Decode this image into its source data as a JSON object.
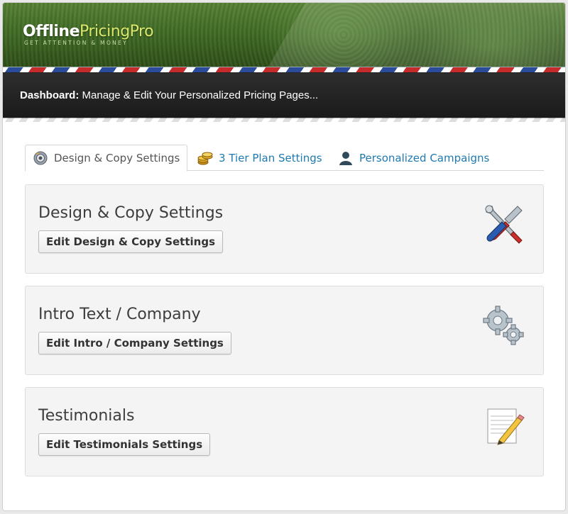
{
  "header": {
    "logo_part1": "Offline",
    "logo_part2": "PricingPro",
    "logo_tagline": "GET ATTENTION & MONEY",
    "dashboard_label": "Dashboard:",
    "dashboard_text": " Manage & Edit Your Personalized Pricing Pages..."
  },
  "tabs": [
    {
      "label": "Design & Copy Settings",
      "icon": "palette-gear-icon",
      "active": true
    },
    {
      "label": "3 Tier Plan Settings",
      "icon": "coins-icon",
      "active": false
    },
    {
      "label": "Personalized Campaigns",
      "icon": "user-icon",
      "active": false
    }
  ],
  "panels": [
    {
      "title": "Design & Copy Settings",
      "button": "Edit Design & Copy Settings",
      "icon": "tools-icon"
    },
    {
      "title": "Intro Text / Company",
      "button": "Edit Intro / Company Settings",
      "icon": "gears-icon"
    },
    {
      "title": "Testimonials",
      "button": "Edit Testimonials Settings",
      "icon": "document-pencil-icon"
    }
  ],
  "colors": {
    "tab_link": "#1f7ab0",
    "header_green": "#3f6a24",
    "logo_accent": "#d9e86b"
  }
}
